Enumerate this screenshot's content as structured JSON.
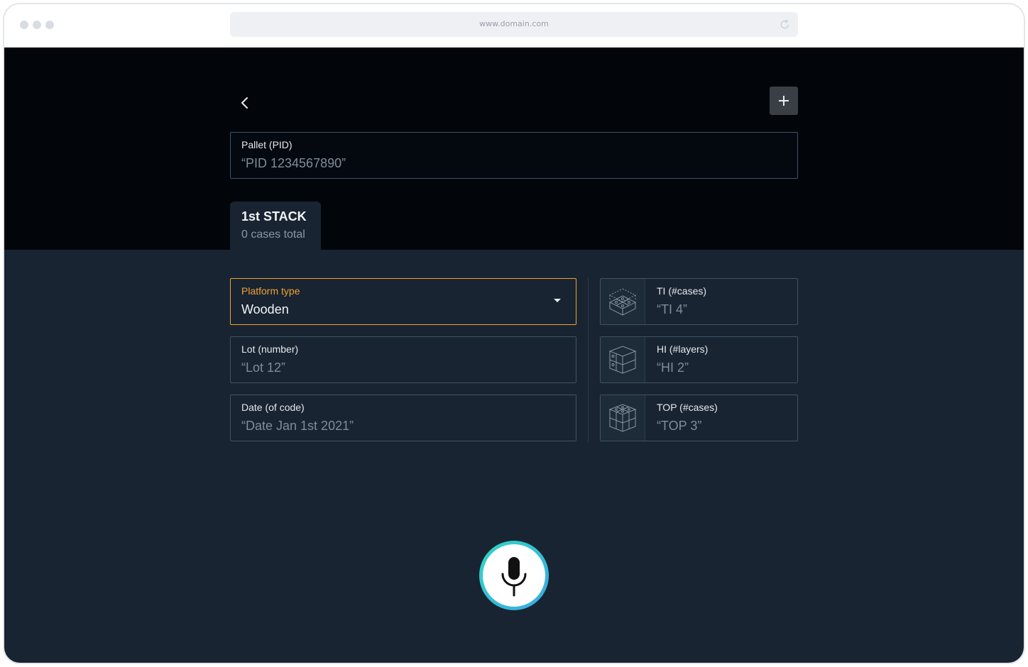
{
  "browser": {
    "url": "www.domain.com"
  },
  "header": {
    "back_icon": "chevron-left-icon",
    "add_icon": "plus-icon"
  },
  "pallet": {
    "label": "Pallet (PID)",
    "value": "“PID 1234567890”"
  },
  "stack_tab": {
    "title": "1st STACK",
    "subtitle": "0 cases total"
  },
  "form": {
    "platform_type": {
      "label": "Platform type",
      "value": "Wooden"
    },
    "lot": {
      "label": "Lot (number)",
      "value": "“Lot 12”"
    },
    "date": {
      "label": "Date (of code)",
      "value": "“Date Jan 1st 2021”"
    },
    "ti": {
      "label": "TI (#cases)",
      "value": "“TI 4”",
      "icon": "cube-layer-icon"
    },
    "hi": {
      "label": "HI (#layers)",
      "value": "“HI 2”",
      "icon": "cube-stack-icon"
    },
    "top": {
      "label": "TOP (#cases)",
      "value": "“TOP 3”",
      "icon": "cube-top-icon"
    }
  },
  "voice": {
    "icon": "microphone-icon"
  },
  "colors": {
    "top_background": "#02060b",
    "panel_background": "#182431",
    "accent_orange": "#f2a234",
    "mic_gradient_start": "#2fd6c3",
    "mic_gradient_end": "#3aa8e6"
  }
}
